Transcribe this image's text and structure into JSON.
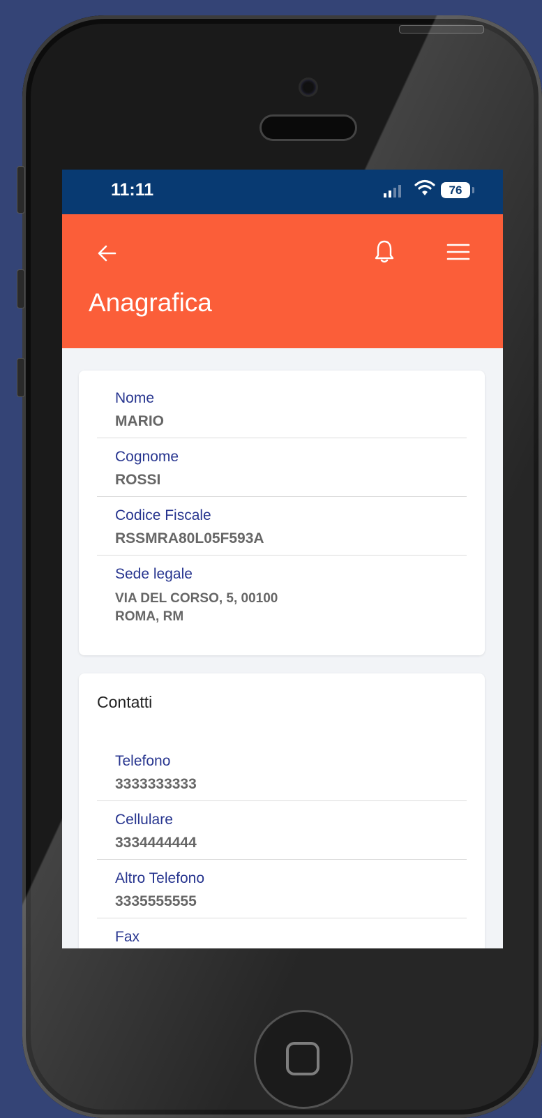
{
  "status_bar": {
    "time": "11:11",
    "battery": "76"
  },
  "app_bar": {
    "title": "Anagrafica"
  },
  "anagrafica": {
    "fields": [
      {
        "label": "Nome",
        "value": "MARIO"
      },
      {
        "label": "Cognome",
        "value": "ROSSI"
      },
      {
        "label": "Codice Fiscale",
        "value": "RSSMRA80L05F593A"
      },
      {
        "label": "Sede legale",
        "value_lines": [
          "VIA DEL CORSO,  5, 00100",
          "ROMA, RM"
        ]
      }
    ]
  },
  "contatti": {
    "title": "Contatti",
    "fields": [
      {
        "label": "Telefono",
        "value": "3333333333"
      },
      {
        "label": "Cellulare",
        "value": "3334444444"
      },
      {
        "label": "Altro Telefono",
        "value": "3335555555"
      },
      {
        "label": "Fax",
        "value": ""
      }
    ]
  },
  "colors": {
    "background": "#344476",
    "status_bar": "#083a72",
    "app_bar": "#fb5e39",
    "label": "#27358f"
  },
  "icons": [
    "back-arrow-icon",
    "bell-icon",
    "menu-icon",
    "wifi-icon",
    "signal-icon",
    "battery-icon",
    "home-button-icon"
  ]
}
